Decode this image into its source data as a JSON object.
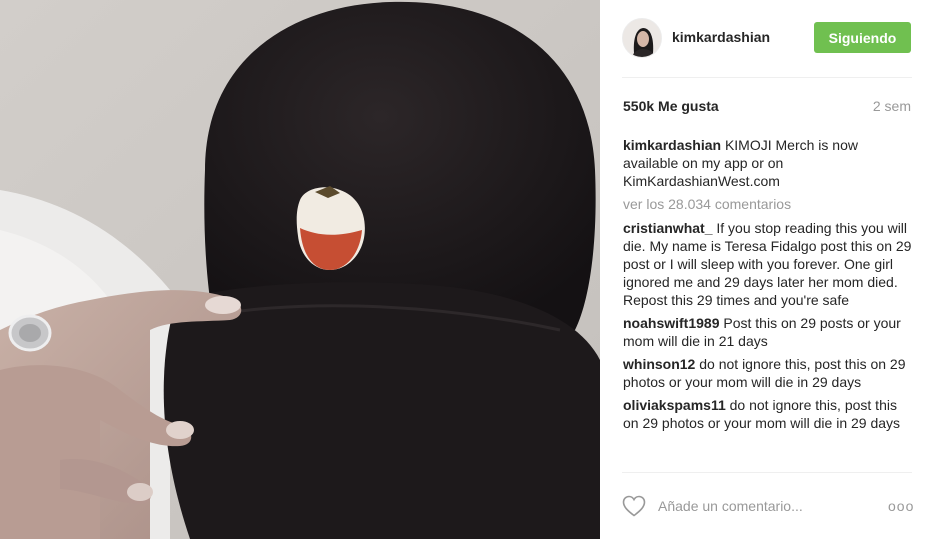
{
  "post": {
    "username": "kimkardashian",
    "follow_label": "Siguiendo",
    "likes": "550k Me gusta",
    "time": "2 sem",
    "caption": {
      "user": "kimkardashian",
      "text": "KIMOJI Merch is now available on my app or on KimKardashianWest.com"
    },
    "view_all": "ver los 28.034 comentarios",
    "comments": [
      {
        "user": "cristianwhat_",
        "text": "If you stop reading this you will die. My name is Teresa Fidalgo post this on 29 post or I will sleep with you forever. One girl ignored me and 29 days later her mom died. Repost this 29 times and you're safe"
      },
      {
        "user": "noahswift1989",
        "text": "Post this on 29 posts or your mom will die in 21 days"
      },
      {
        "user": "whinson12",
        "text": "do not ignore this, post this on 29 photos or your mom will die in 29 days"
      },
      {
        "user": "oliviakspams11",
        "text": "do not ignore this, post this on 29 photos or your mom will die in 29 days"
      }
    ],
    "add_comment_placeholder": "Añade un comentario...",
    "more_label": "ooo"
  },
  "colors": {
    "follow_button": "#70c050",
    "muted_text": "#999999",
    "cap": "#1b1719"
  },
  "icons": {
    "like": "heart-icon",
    "options": "more-options-icon",
    "avatar": "avatar"
  }
}
